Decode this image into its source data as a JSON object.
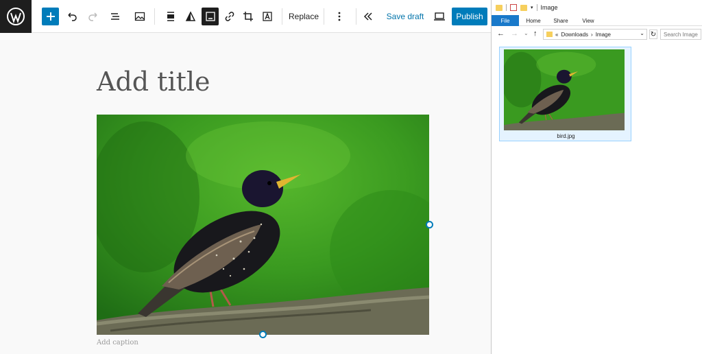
{
  "toolbar": {
    "replace_label": "Replace",
    "save_draft_label": "Save draft",
    "publish_label": "Publish"
  },
  "editor": {
    "title_placeholder": "Add title",
    "caption_placeholder": "Add caption"
  },
  "explorer": {
    "window_title": "Image",
    "tabs": [
      "File",
      "Home",
      "Share",
      "View"
    ],
    "breadcrumb": [
      "Downloads",
      "Image"
    ],
    "search_placeholder": "Search Image",
    "file_name": "bird.jpg"
  },
  "colors": {
    "accent": "#007cba",
    "wp_dark": "#1e1e1e",
    "explorer_file_tab": "#1979ca"
  }
}
